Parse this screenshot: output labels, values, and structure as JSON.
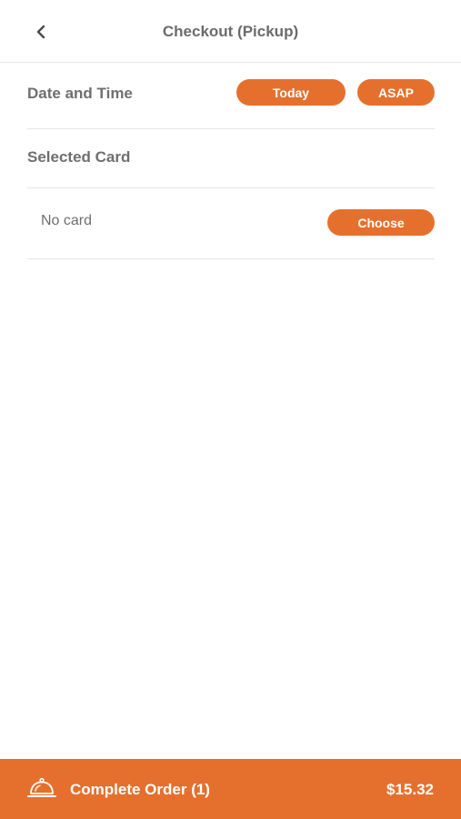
{
  "header": {
    "title": "Checkout (Pickup)",
    "back_icon": "chevron-left-icon"
  },
  "date_time": {
    "label": "Date and Time",
    "day": "Today",
    "time": "ASAP"
  },
  "selected_card": {
    "label": "Selected Card",
    "value": "No card",
    "choose_label": "Choose"
  },
  "footer": {
    "icon": "service-bell-icon",
    "label": "Complete Order (1)",
    "total": "$15.32"
  },
  "colors": {
    "accent": "#e5702d",
    "text": "#6b6b6b",
    "divider": "#e4e4e4"
  }
}
